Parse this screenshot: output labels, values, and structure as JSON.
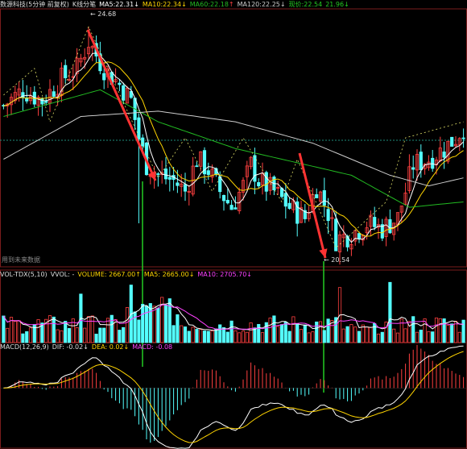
{
  "main_header": {
    "title": "数源科技(5分钟 前复权)",
    "mode": "K线分笔",
    "ma5_label": "MA5:",
    "ma5_value": "22.31",
    "ma10_label": "MA10:",
    "ma10_value": "22.34",
    "ma60_label": "MA60:",
    "ma60_value": "22.18",
    "ma120_label": "MA120:",
    "ma120_value": "22.25",
    "now_label": "现价:",
    "now_value": "22.54",
    "extra_value": "21.96"
  },
  "volume_header": {
    "title": "VOL-TDX(5,10)",
    "vvol": "VVOL: -",
    "volume": "VOLUME: 2667.00",
    "ma5": "MA5: 2665.00",
    "ma10": "MA10: 2705.70"
  },
  "macd_header": {
    "title": "MACD(12,26,9)",
    "dif": "DIF: -0.02",
    "dea": "DEA: 0.02",
    "macd": "MACD: -0.08"
  },
  "annotations": {
    "high": "24.68",
    "low": "20.54",
    "watermark": "用到未来数据"
  },
  "colors": {
    "up": "#ff4040",
    "down": "#54ffff",
    "ma5": "#ffffff",
    "ma10": "#ffd400",
    "ma60": "#22bb22",
    "ma120": "#cccccc",
    "vol_ma5": "#ffffff",
    "vol_ma10": "#ff40ff",
    "dif": "#ffffff",
    "dea": "#ffd400",
    "arrow": "#ff3333",
    "marker": "#22cc22",
    "price_line": "#1e8c7a",
    "border": "#7a1c1c"
  },
  "chart_data": {
    "type": "candlestick",
    "y_range": [
      20.2,
      25.0
    ],
    "high_point": {
      "index": 22,
      "value": 24.68
    },
    "low_point": {
      "index": 86,
      "value": 20.54
    },
    "close_path": [
      [
        0,
        23.2
      ],
      [
        5,
        23.5
      ],
      [
        10,
        23.3
      ],
      [
        15,
        23.7
      ],
      [
        19,
        23.9
      ],
      [
        22,
        24.4
      ],
      [
        26,
        23.9
      ],
      [
        30,
        23.6
      ],
      [
        33,
        23.3
      ],
      [
        35,
        22.6
      ],
      [
        37,
        22.1
      ],
      [
        40,
        21.9
      ],
      [
        44,
        21.8
      ],
      [
        47,
        21.6
      ],
      [
        50,
        22.2
      ],
      [
        53,
        22.0
      ],
      [
        56,
        21.6
      ],
      [
        59,
        21.3
      ],
      [
        62,
        21.7
      ],
      [
        64,
        22.1
      ],
      [
        66,
        21.8
      ],
      [
        70,
        21.6
      ],
      [
        74,
        21.3
      ],
      [
        78,
        21.1
      ],
      [
        81,
        21.7
      ],
      [
        84,
        21.2
      ],
      [
        86,
        20.7
      ],
      [
        90,
        20.8
      ],
      [
        94,
        21.0
      ],
      [
        98,
        20.9
      ],
      [
        102,
        21.1
      ],
      [
        104,
        21.6
      ],
      [
        106,
        22.1
      ],
      [
        110,
        22.2
      ],
      [
        114,
        22.4
      ],
      [
        117,
        22.6
      ],
      [
        119,
        22.8
      ]
    ],
    "ma60_path": [
      [
        0,
        23.0
      ],
      [
        25,
        23.5
      ],
      [
        40,
        22.9
      ],
      [
        60,
        22.4
      ],
      [
        90,
        21.9
      ],
      [
        105,
        21.3
      ],
      [
        119,
        21.4
      ]
    ],
    "ma120_path": [
      [
        0,
        22.2
      ],
      [
        20,
        23.0
      ],
      [
        40,
        23.1
      ],
      [
        60,
        22.9
      ],
      [
        80,
        22.5
      ],
      [
        100,
        21.9
      ],
      [
        110,
        21.7
      ],
      [
        119,
        21.85
      ]
    ],
    "volume": {
      "range": [
        0,
        6000
      ]
    },
    "macd": {
      "range": [
        -0.5,
        0.3
      ]
    }
  }
}
